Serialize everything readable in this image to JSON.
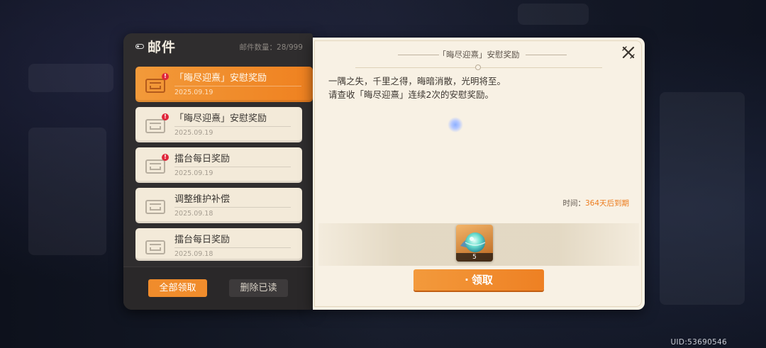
{
  "mail_panel": {
    "title": "邮件",
    "count_label": "邮件数量：28/999"
  },
  "mails": [
    {
      "title": "「晦尽迎熹」安慰奖励",
      "date": "2025.09.19",
      "unread": true,
      "selected": true
    },
    {
      "title": "「晦尽迎熹」安慰奖励",
      "date": "2025.09.19",
      "unread": true,
      "selected": false
    },
    {
      "title": "擂台每日奖励",
      "date": "2025.09.19",
      "unread": true,
      "selected": false
    },
    {
      "title": "调整维护补偿",
      "date": "2025.09.18",
      "unread": false,
      "selected": false
    },
    {
      "title": "擂台每日奖励",
      "date": "2025.09.18",
      "unread": false,
      "selected": false
    }
  ],
  "badge_symbol": "!",
  "footer": {
    "claim_all_label": "全部领取",
    "delete_read_label": "删除已读"
  },
  "detail": {
    "title": "「晦尽迎熹」安慰奖励",
    "body_line1": "一隅之失，千里之得，晦暗消散，光明将至。",
    "body_line2": "请查收「晦尽迎熹」连续2次的安慰奖励。",
    "time_label": "时间：",
    "time_value": "364天后到期",
    "reward_qty": "5",
    "claim_label": "领取",
    "claim_prefix": "·"
  },
  "uid": "UID:53690546",
  "icons": {
    "close": "close-icon",
    "mail": "mail-chest-icon",
    "reward": "orb-item-icon"
  },
  "colors": {
    "accent": "#f08c2c",
    "badge": "#e0263a",
    "expiry": "#ec7c1e"
  }
}
